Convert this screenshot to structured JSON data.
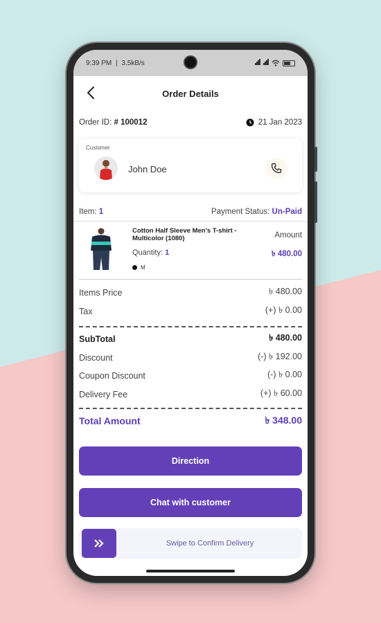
{
  "status_bar": {
    "time": "9:39 PM",
    "speed": "3.5kB/s"
  },
  "header": {
    "title": "Order Details"
  },
  "order": {
    "id_label": "Order ID:",
    "id_value": "# 100012",
    "date": "21 Jan 2023"
  },
  "customer": {
    "label": "Customer",
    "name": "John Doe"
  },
  "summary": {
    "item_label": "Item:",
    "item_count": "1",
    "payment_label": "Payment Status:",
    "payment_value": "Un-Paid"
  },
  "product": {
    "name": "Cotton Half Sleeve Men's T-shirt - Multicolor (1080)",
    "quantity_label": "Quantity:",
    "quantity_value": "1",
    "variant": "M",
    "amount_label": "Amount",
    "amount_value": "৳ 480.00"
  },
  "pricing": {
    "items_price_label": "Items Price",
    "items_price_value": "৳ 480.00",
    "tax_label": "Tax",
    "tax_value": "(+) ৳ 0.00",
    "subtotal_label": "SubTotal",
    "subtotal_value": "৳ 480.00",
    "discount_label": "Discount",
    "discount_value": "(-) ৳ 192.00",
    "coupon_label": "Coupon Discount",
    "coupon_value": "(-) ৳ 0.00",
    "delivery_label": "Delivery Fee",
    "delivery_value": "(+) ৳ 60.00",
    "total_label": "Total Amount",
    "total_value": "৳ 348.00"
  },
  "actions": {
    "direction_label": "Direction",
    "chat_label": "Chat with customer",
    "swipe_label": "Swipe to Confirm Delivery"
  },
  "colors": {
    "accent": "#6340b8",
    "bg_teal": "#cdeaea",
    "bg_pink": "#f6c8c8"
  }
}
